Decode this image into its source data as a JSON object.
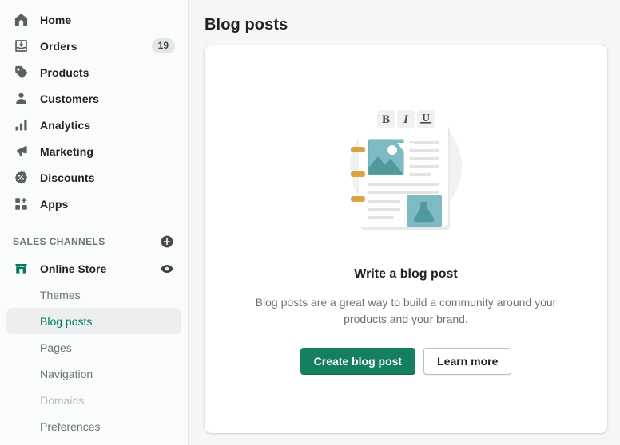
{
  "sidebar": {
    "nav": [
      {
        "label": "Home",
        "icon": "home-icon",
        "badge": null
      },
      {
        "label": "Orders",
        "icon": "orders-icon",
        "badge": "19"
      },
      {
        "label": "Products",
        "icon": "products-tag-icon",
        "badge": null
      },
      {
        "label": "Customers",
        "icon": "customers-person-icon",
        "badge": null
      },
      {
        "label": "Analytics",
        "icon": "analytics-bar-chart-icon",
        "badge": null
      },
      {
        "label": "Marketing",
        "icon": "marketing-megaphone-icon",
        "badge": null
      },
      {
        "label": "Discounts",
        "icon": "discounts-percent-icon",
        "badge": null
      },
      {
        "label": "Apps",
        "icon": "apps-grid-plus-icon",
        "badge": null
      }
    ],
    "sales_channels": {
      "title": "SALES CHANNELS",
      "add_icon": "add-circle-icon",
      "channel": {
        "label": "Online Store",
        "icon": "online-store-icon",
        "view_icon": "eye-icon"
      },
      "items": [
        {
          "label": "Themes",
          "state": "normal"
        },
        {
          "label": "Blog posts",
          "state": "active"
        },
        {
          "label": "Pages",
          "state": "normal"
        },
        {
          "label": "Navigation",
          "state": "normal"
        },
        {
          "label": "Domains",
          "state": "disabled"
        },
        {
          "label": "Preferences",
          "state": "normal"
        }
      ]
    }
  },
  "main": {
    "page_title": "Blog posts",
    "empty_state": {
      "illustration": "blog-post-editor-illustration",
      "toolbar_glyphs": [
        "B",
        "I",
        "U"
      ],
      "heading": "Write a blog post",
      "body": "Blog posts are a great way to build a community around your products and your brand.",
      "primary_action": "Create blog post",
      "secondary_action": "Learn more"
    }
  },
  "colors": {
    "accent_green": "#157f5f",
    "active_link_green": "#007a5c",
    "page_background": "#f6f6f7",
    "sidebar_background": "#fafbfb",
    "card_background": "#ffffff",
    "text_primary": "#202223",
    "text_subdued": "#6d7175",
    "text_disabled": "#babec3",
    "illustration_teal": "#4f9a9c",
    "illustration_teal_light": "#7ebac2",
    "illustration_orange": "#d9a441"
  }
}
